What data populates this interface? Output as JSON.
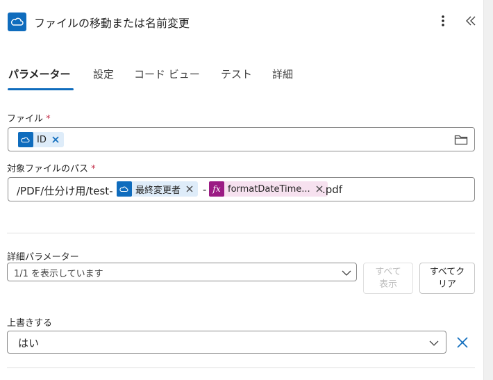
{
  "header": {
    "title": "ファイルの移動または名前変更"
  },
  "tabs": [
    {
      "label": "パラメーター",
      "active": true
    },
    {
      "label": "設定"
    },
    {
      "label": "コード ビュー"
    },
    {
      "label": "テスト"
    },
    {
      "label": "詳細"
    }
  ],
  "file_field": {
    "label": "ファイル",
    "required_mark": "*",
    "token_label": "ID"
  },
  "path_field": {
    "label": "対象ファイルのパス",
    "required_mark": "*",
    "prefix": "/PDF/仕分け用/test-",
    "token1_label": "最終変更者",
    "separator": "-",
    "token2_icon_text": "fx",
    "token2_label": "formatDateTime...",
    "suffix": ".pdf"
  },
  "advanced": {
    "label": "詳細パラメーター",
    "select_value": "1/1 を表示しています",
    "show_all_label": "すべて\n表示",
    "clear_all_label": "すべてク\nリア"
  },
  "overwrite": {
    "label": "上書きする",
    "value": "はい"
  },
  "colors": {
    "accent": "#0f6cbd",
    "expression": "#9b1c84",
    "required": "#c4314b"
  },
  "icons": [
    "onedrive-icon",
    "more-icon",
    "collapse-icon",
    "close-icon",
    "folder-icon",
    "chevron-down-icon",
    "function-icon"
  ]
}
